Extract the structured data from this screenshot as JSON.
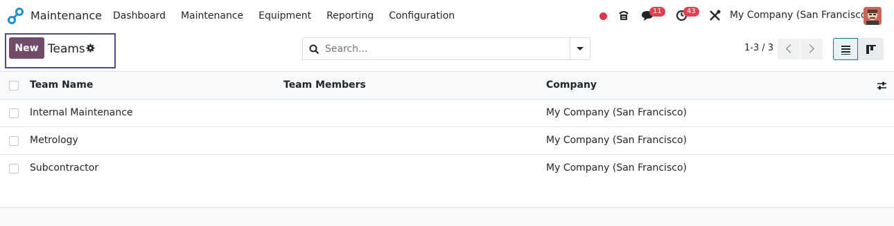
{
  "app": {
    "name": "Maintenance"
  },
  "menu": {
    "items": [
      {
        "label": "Dashboard"
      },
      {
        "label": "Maintenance"
      },
      {
        "label": "Equipment"
      },
      {
        "label": "Reporting"
      },
      {
        "label": "Configuration"
      }
    ]
  },
  "systray": {
    "messages_count": "11",
    "activities_count": "43",
    "company": "My Company (San Francisco)"
  },
  "control_panel": {
    "new_label": "New",
    "title": "Teams",
    "search_placeholder": "Search...",
    "pager": "1-3 / 3"
  },
  "table": {
    "columns": [
      "Team Name",
      "Team Members",
      "Company"
    ],
    "rows": [
      {
        "name": "Internal Maintenance",
        "members": "",
        "company": "My Company (San Francisco)"
      },
      {
        "name": "Metrology",
        "members": "",
        "company": "My Company (San Francisco)"
      },
      {
        "name": "Subcontractor",
        "members": "",
        "company": "My Company (San Francisco)"
      }
    ]
  },
  "colors": {
    "brand": "#714b67",
    "accent": "#017e84",
    "badge": "#e0404f",
    "status_dot": "#dc3545"
  },
  "icons": [
    "app-logo-icon",
    "phone-icon",
    "chat-icon",
    "clock-icon",
    "tools-icon",
    "gear-icon",
    "search-icon",
    "caret-down-icon",
    "chevron-left-icon",
    "chevron-right-icon",
    "list-view-icon",
    "kanban-view-icon",
    "optional-columns-icon"
  ]
}
